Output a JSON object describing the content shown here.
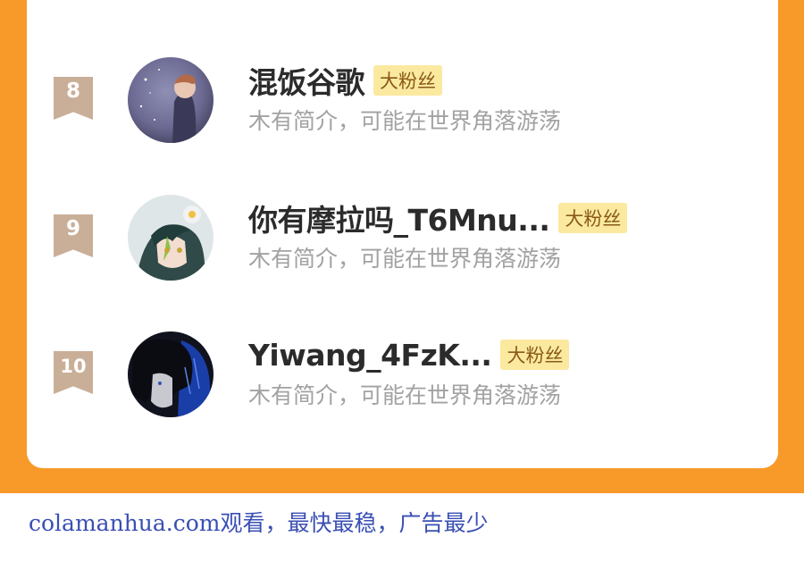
{
  "fans": [
    {
      "rank": "8",
      "name": "混饭谷歌",
      "badge": "大粉丝",
      "bio": "木有简介，可能在世界角落游荡",
      "avatar_icon": "avatar-boy-starry-sky"
    },
    {
      "rank": "9",
      "name": "你有摩拉吗_T6Mnu...",
      "badge": "大粉丝",
      "bio": "木有简介，可能在世界角落游荡",
      "avatar_icon": "avatar-green-hair-anime"
    },
    {
      "rank": "10",
      "name": "Yiwang_4FzK...",
      "badge": "大粉丝",
      "bio": "木有简介，可能在世界角落游荡",
      "avatar_icon": "avatar-dark-hair-anime"
    }
  ],
  "footer": {
    "text": "colamanhua.com观看，最快最稳，广告最少"
  },
  "colors": {
    "accent": "#f79a2a",
    "badge_bg": "#fbe9a0",
    "rank_bg": "#c9ae98",
    "footer_text": "#3a4fb3"
  }
}
